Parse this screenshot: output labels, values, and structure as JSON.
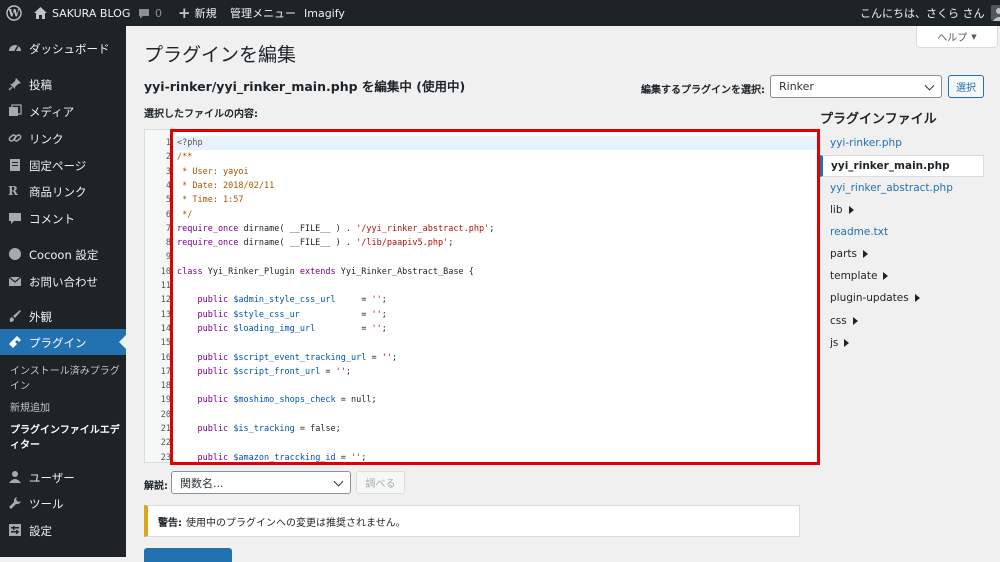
{
  "adminbar": {
    "site_name": "SAKURA BLOG",
    "comments_count": "0",
    "new_label": "新規",
    "admin_menu_label": "管理メニュー",
    "imagify_label": "Imagify",
    "greeting": "こんにちは、さくら さん"
  },
  "sidebar": {
    "items": [
      {
        "label": "ダッシュボード",
        "icon": "dashboard-icon"
      },
      {
        "label": "投稿",
        "icon": "pin-icon"
      },
      {
        "label": "メディア",
        "icon": "media-icon"
      },
      {
        "label": "リンク",
        "icon": "link-icon"
      },
      {
        "label": "固定ページ",
        "icon": "page-icon"
      },
      {
        "label": "商品リンク",
        "icon": "r-icon"
      },
      {
        "label": "コメント",
        "icon": "comment-icon"
      },
      {
        "label": "Cocoon 設定",
        "icon": "circle-icon"
      },
      {
        "label": "お問い合わせ",
        "icon": "mail-icon"
      },
      {
        "label": "外観",
        "icon": "brush-icon"
      },
      {
        "label": "プラグイン",
        "icon": "plugin-icon"
      },
      {
        "label": "ユーザー",
        "icon": "user-icon"
      },
      {
        "label": "ツール",
        "icon": "wrench-icon"
      },
      {
        "label": "設定",
        "icon": "settings-icon"
      }
    ],
    "submenu": [
      "インストール済みプラグイン",
      "新規追加",
      "プラグインファイルエディター"
    ]
  },
  "page": {
    "title": "プラグインを編集",
    "help_label": "ヘルプ",
    "editing_heading": "yyi-rinker/yyi_rinker_main.php を編集中 (使用中)",
    "select_plugin_label": "編集するプラグインを選択:",
    "selected_plugin": "Rinker",
    "select_button": "選択",
    "file_content_label": "選択したファイルの内容:",
    "plugin_files_heading": "プラグインファイル",
    "doc_label": "解説:",
    "function_placeholder": "関数名...",
    "lookup_button": "調べる",
    "warning_strong": "警告:",
    "warning_text": "使用中のプラグインへの変更は推奨されません。"
  },
  "files": [
    {
      "name": "yyi-rinker.php",
      "type": "file"
    },
    {
      "name": "yyi_rinker_main.php",
      "type": "current"
    },
    {
      "name": "yyi_rinker_abstract.php",
      "type": "file"
    },
    {
      "name": "lib",
      "type": "dir"
    },
    {
      "name": "readme.txt",
      "type": "file"
    },
    {
      "name": "parts",
      "type": "dir"
    },
    {
      "name": "template",
      "type": "dir"
    },
    {
      "name": "plugin-updates",
      "type": "dir"
    },
    {
      "name": "css",
      "type": "dir"
    },
    {
      "name": "js",
      "type": "dir"
    }
  ],
  "code_lines": [
    [
      [
        "ph",
        "<?php"
      ]
    ],
    [
      [
        "c",
        "/**"
      ]
    ],
    [
      [
        "c",
        " * User: yayoi"
      ]
    ],
    [
      [
        "c",
        " * Date: 2018/02/11"
      ]
    ],
    [
      [
        "c",
        " * Time: 1:57"
      ]
    ],
    [
      [
        "c",
        " */"
      ]
    ],
    [
      [
        "k",
        "require_once"
      ],
      [
        "d",
        " dirname( __FILE__ ) . "
      ],
      [
        "s",
        "'/yyi_rinker_abstract.php'"
      ],
      [
        "d",
        ";"
      ]
    ],
    [
      [
        "k",
        "require_once"
      ],
      [
        "d",
        " dirname( __FILE__ ) . "
      ],
      [
        "s",
        "'/lib/paapiv5.php'"
      ],
      [
        "d",
        ";"
      ]
    ],
    [],
    [
      [
        "k",
        "class"
      ],
      [
        "d",
        " Yyi_Rinker_Plugin "
      ],
      [
        "k",
        "extends"
      ],
      [
        "d",
        " Yyi_Rinker_Abstract_Base {"
      ]
    ],
    [],
    [
      [
        "k",
        "    public"
      ],
      [
        "d",
        " "
      ],
      [
        "v",
        "$admin_style_css_url"
      ],
      [
        "d",
        "     = "
      ],
      [
        "s",
        "''"
      ],
      [
        "d",
        ";"
      ]
    ],
    [
      [
        "k",
        "    public"
      ],
      [
        "d",
        " "
      ],
      [
        "v",
        "$style_css_ur"
      ],
      [
        "d",
        "            = "
      ],
      [
        "s",
        "''"
      ],
      [
        "d",
        ";"
      ]
    ],
    [
      [
        "k",
        "    public"
      ],
      [
        "d",
        " "
      ],
      [
        "v",
        "$loading_img_url"
      ],
      [
        "d",
        "         = "
      ],
      [
        "s",
        "''"
      ],
      [
        "d",
        ";"
      ]
    ],
    [],
    [
      [
        "k",
        "    public"
      ],
      [
        "d",
        " "
      ],
      [
        "v",
        "$script_event_tracking_url"
      ],
      [
        "d",
        " = "
      ],
      [
        "s",
        "''"
      ],
      [
        "d",
        ";"
      ]
    ],
    [
      [
        "k",
        "    public"
      ],
      [
        "d",
        " "
      ],
      [
        "v",
        "$script_front_url"
      ],
      [
        "d",
        " = "
      ],
      [
        "s",
        "''"
      ],
      [
        "d",
        ";"
      ]
    ],
    [],
    [
      [
        "k",
        "    public"
      ],
      [
        "d",
        " "
      ],
      [
        "v",
        "$moshimo_shops_check"
      ],
      [
        "d",
        " = null;"
      ]
    ],
    [],
    [
      [
        "k",
        "    public"
      ],
      [
        "d",
        " "
      ],
      [
        "v",
        "$is_tracking"
      ],
      [
        "d",
        " = false;"
      ]
    ],
    [],
    [
      [
        "k",
        "    public"
      ],
      [
        "d",
        " "
      ],
      [
        "v",
        "$amazon_traccking_id"
      ],
      [
        "d",
        " = "
      ],
      [
        "s",
        "''"
      ],
      [
        "d",
        ";"
      ]
    ]
  ],
  "colors": {
    "admin_dark": "#1d2327",
    "accent_blue": "#2271b1",
    "highlight_red": "#e00000",
    "warning_yellow": "#dba617"
  }
}
